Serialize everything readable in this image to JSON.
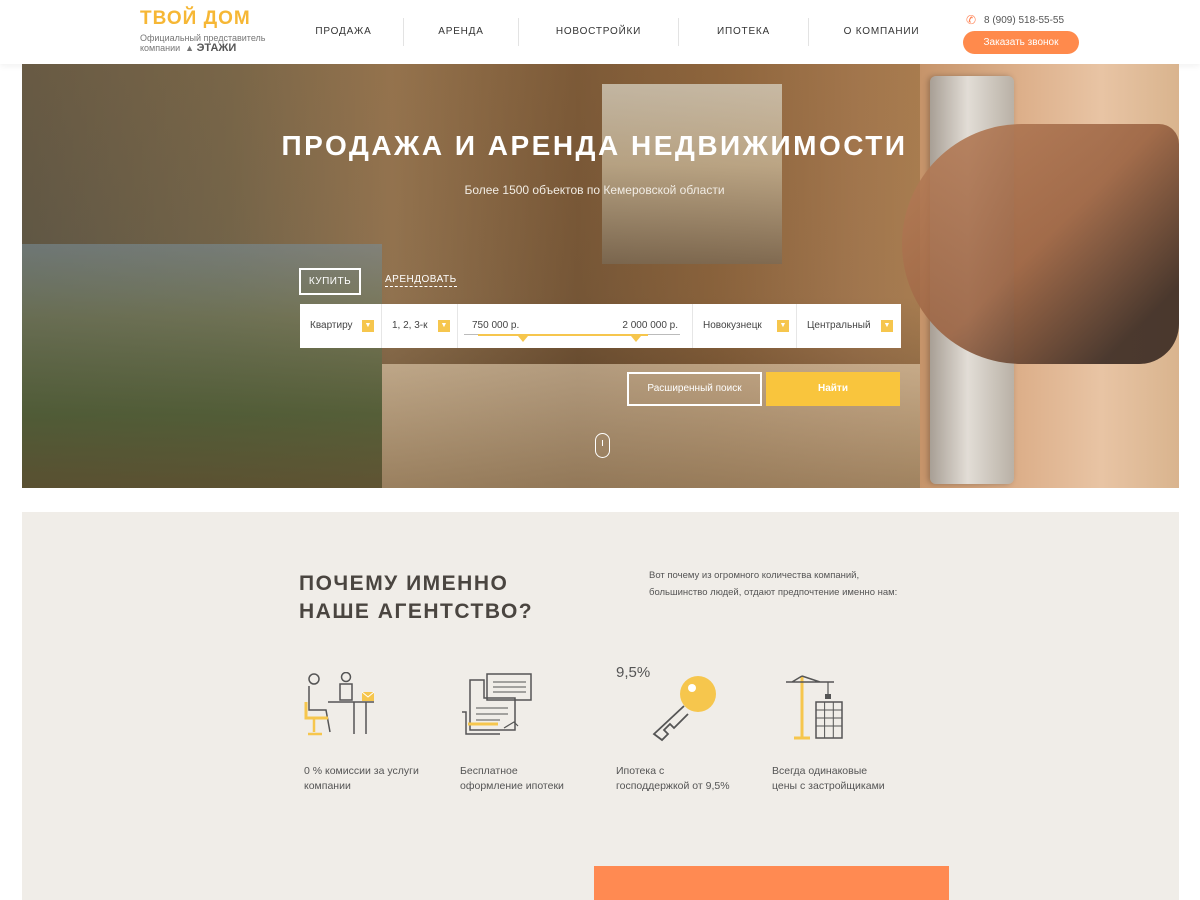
{
  "header": {
    "logo_title": "ТВОЙ ДОМ",
    "logo_sub_1": "Официальный представитель",
    "logo_sub_2": "компании",
    "logo_brand": "ЭТАЖИ",
    "nav": [
      {
        "label": "ПРОДАЖА",
        "width": 120
      },
      {
        "label": "АРЕНДА",
        "width": 115
      },
      {
        "label": "НОВОСТРОЙКИ",
        "width": 160
      },
      {
        "label": "ИПОТЕКА",
        "width": 130
      },
      {
        "label": "О КОМПАНИИ",
        "width": 145
      }
    ],
    "phone": "8 (909) 518-55-55",
    "callback_label": "Заказать звонок"
  },
  "hero": {
    "title": "ПРОДАЖА И АРЕНДА НЕДВИЖИМОСТИ",
    "subtitle": "Более 1500 объектов по Кемеровской области",
    "tab_buy": "КУПИТЬ",
    "tab_rent": "АРЕНДОВАТЬ",
    "search": {
      "type_value": "Квартиру",
      "rooms_value": "1, 2, 3-к",
      "price_min": "750 000 р.",
      "price_max": "2 000 000 р.",
      "city_value": "Новокузнецк",
      "district_value": "Центральный"
    },
    "advanced_label": "Расширенный поиск",
    "find_label": "Найти"
  },
  "why": {
    "title": "ПОЧЕМУ ИМЕННО\nНАШЕ АГЕНТСТВО?",
    "description": "Вот почему из огромного количества компаний, большинство людей, отдают предпочтение именно нам:",
    "features": [
      {
        "icon": "office-desk-icon",
        "text": "0 % комиссии за услуги компании"
      },
      {
        "icon": "document-form-icon",
        "text": "Бесплатное оформление ипотеки"
      },
      {
        "icon": "key-icon",
        "rate": "9,5%",
        "text": "Ипотека с господдержкой от 9,5%"
      },
      {
        "icon": "construction-crane-icon",
        "text": "Всегда одинаковые цены с застройщиками"
      }
    ]
  },
  "colors": {
    "accent_yellow": "#f9c53d",
    "accent_orange": "#ff8a4c",
    "section_bg": "#f0ede8"
  }
}
